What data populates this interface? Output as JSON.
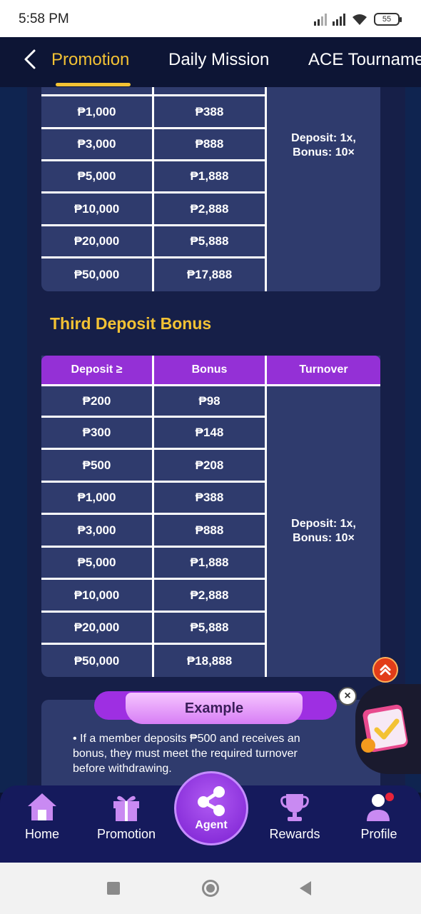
{
  "status_bar": {
    "time": "5:58 PM",
    "battery": "55"
  },
  "header": {
    "tabs": [
      {
        "label": "Promotion",
        "active": true
      },
      {
        "label": "Daily Mission",
        "active": false
      },
      {
        "label": "ACE Tourname",
        "active": false
      }
    ]
  },
  "table1": {
    "rows": [
      {
        "deposit": "₱1,000",
        "bonus": "₱388"
      },
      {
        "deposit": "₱3,000",
        "bonus": "₱888"
      },
      {
        "deposit": "₱5,000",
        "bonus": "₱1,888"
      },
      {
        "deposit": "₱10,000",
        "bonus": "₱2,888"
      },
      {
        "deposit": "₱20,000",
        "bonus": "₱5,888"
      },
      {
        "deposit": "₱50,000",
        "bonus": "₱17,888"
      }
    ],
    "turnover_line1": "Deposit: 1x,",
    "turnover_line2": "Bonus: 10×"
  },
  "third_deposit": {
    "title": "Third Deposit Bonus",
    "headers": {
      "deposit": "Deposit ≥",
      "bonus": "Bonus",
      "turnover": "Turnover"
    },
    "rows": [
      {
        "deposit": "₱200",
        "bonus": "₱98"
      },
      {
        "deposit": "₱300",
        "bonus": "₱148"
      },
      {
        "deposit": "₱500",
        "bonus": "₱208"
      },
      {
        "deposit": "₱1,000",
        "bonus": "₱388"
      },
      {
        "deposit": "₱3,000",
        "bonus": "₱888"
      },
      {
        "deposit": "₱5,000",
        "bonus": "₱1,888"
      },
      {
        "deposit": "₱10,000",
        "bonus": "₱2,888"
      },
      {
        "deposit": "₱20,000",
        "bonus": "₱5,888"
      },
      {
        "deposit": "₱50,000",
        "bonus": "₱18,888"
      }
    ],
    "turnover_line1": "Deposit: 1x,",
    "turnover_line2": "Bonus: 10×"
  },
  "example": {
    "title": "Example",
    "text": "• If a member deposits ₱500 and receives an bonus, they must meet the required turnover before withdrawing."
  },
  "nav": {
    "home": "Home",
    "promotion": "Promotion",
    "agent": "Agent",
    "rewards": "Rewards",
    "profile": "Profile"
  },
  "colors": {
    "accent_gold": "#f3c234",
    "header_purple": "#9430d6",
    "table_bg": "#2f3b6d",
    "nav_bg": "#151a5c"
  }
}
